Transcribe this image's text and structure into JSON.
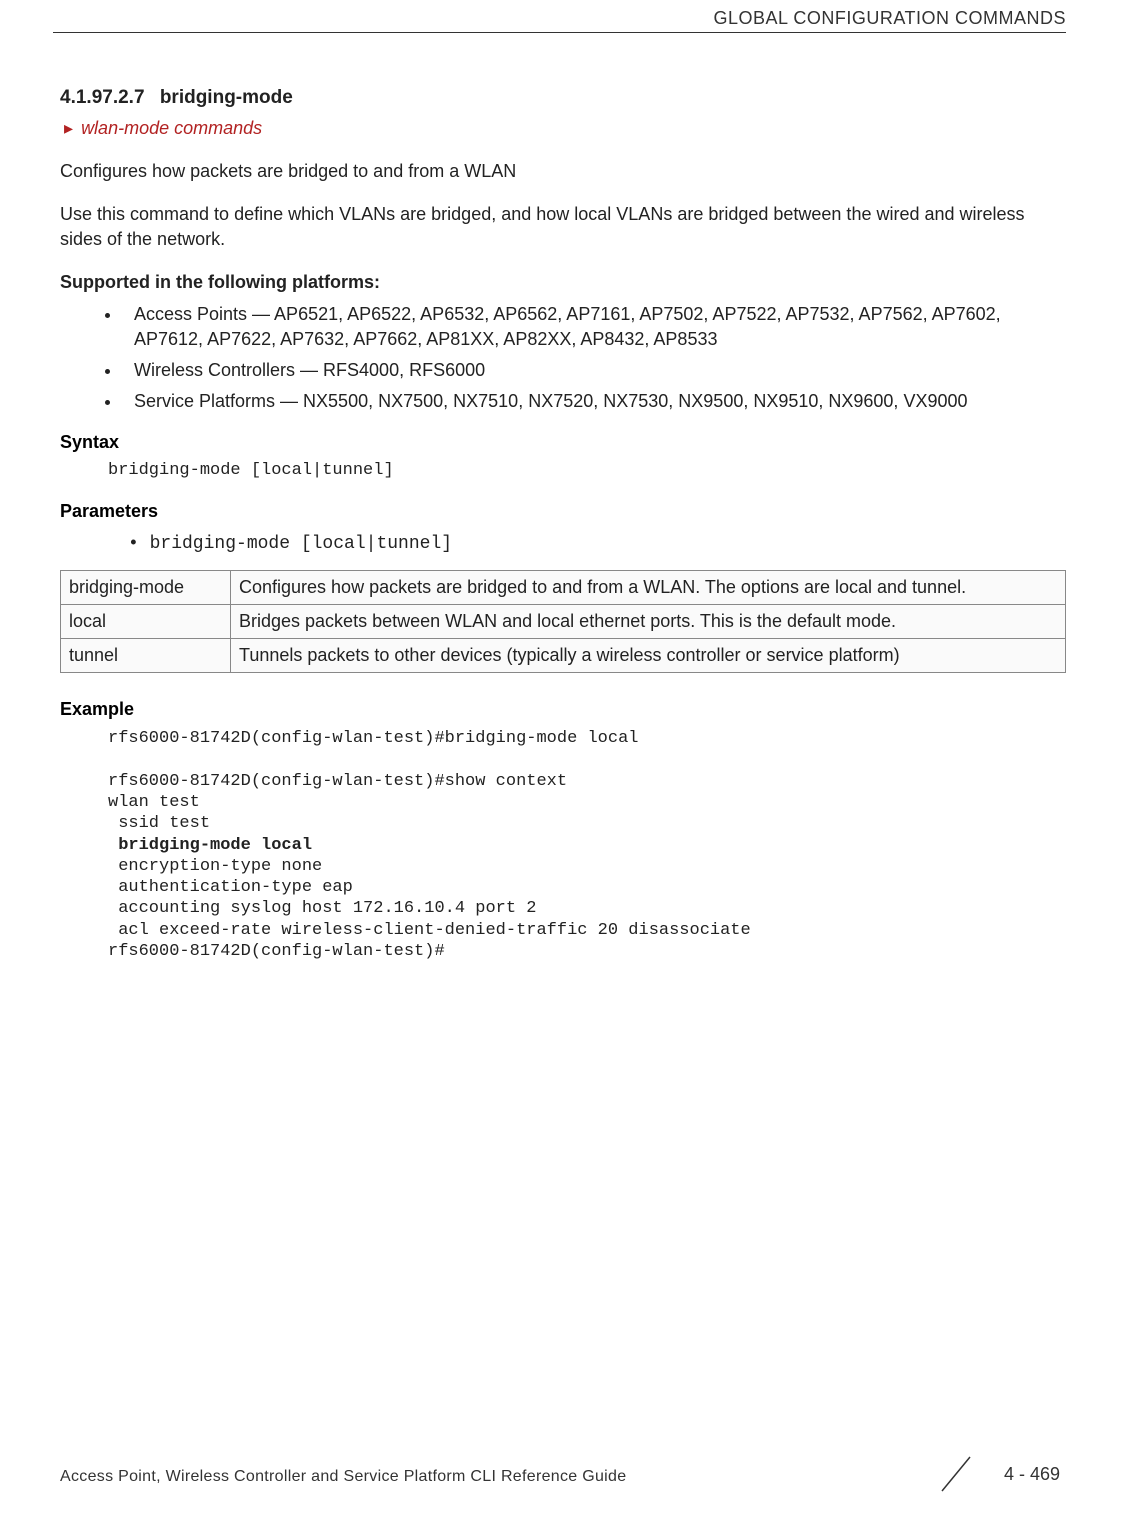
{
  "header": {
    "right_text": "GLOBAL CONFIGURATION COMMANDS"
  },
  "section": {
    "number": "4.1.97.2.7",
    "title": "bridging-mode",
    "breadcrumb": "wlan-mode commands"
  },
  "description": {
    "line1": "Configures how packets are bridged to and from a WLAN",
    "line2": "Use this command to define which VLANs are bridged, and how local VLANs are bridged between the wired and wireless sides of the network."
  },
  "platforms": {
    "heading": "Supported in the following platforms:",
    "items": [
      "Access Points — AP6521, AP6522, AP6532, AP6562, AP7161, AP7502, AP7522, AP7532, AP7562, AP7602, AP7612, AP7622, AP7632, AP7662, AP81XX, AP82XX, AP8432, AP8533",
      "Wireless Controllers — RFS4000, RFS6000",
      "Service Platforms — NX5500, NX7500, NX7510, NX7520, NX7530, NX9500, NX9510, NX9600, VX9000"
    ]
  },
  "syntax": {
    "heading": "Syntax",
    "code": "bridging-mode [local|tunnel]"
  },
  "parameters": {
    "heading": "Parameters",
    "bullet": "• bridging-mode [local|tunnel]",
    "table": [
      {
        "name": "bridging-mode",
        "desc": "Configures how packets are bridged to and from a WLAN. The options are local and tunnel."
      },
      {
        "name": "local",
        "desc": "Bridges packets between WLAN and local ethernet ports. This is the default mode."
      },
      {
        "name": "tunnel",
        "desc": "Tunnels packets to other devices (typically a wireless controller or service platform)"
      }
    ]
  },
  "example": {
    "heading": "Example",
    "lines": [
      "rfs6000-81742D(config-wlan-test)#bridging-mode local",
      "",
      "rfs6000-81742D(config-wlan-test)#show context",
      "wlan test",
      " ssid test",
      " bridging-mode local",
      " encryption-type none",
      " authentication-type eap",
      " accounting syslog host 172.16.10.4 port 2",
      " acl exceed-rate wireless-client-denied-traffic 20 disassociate",
      "rfs6000-81742D(config-wlan-test)#"
    ],
    "bold_line_index": 5
  },
  "footer": {
    "text": "Access Point, Wireless Controller and Service Platform CLI Reference Guide",
    "page": "4 - 469"
  }
}
